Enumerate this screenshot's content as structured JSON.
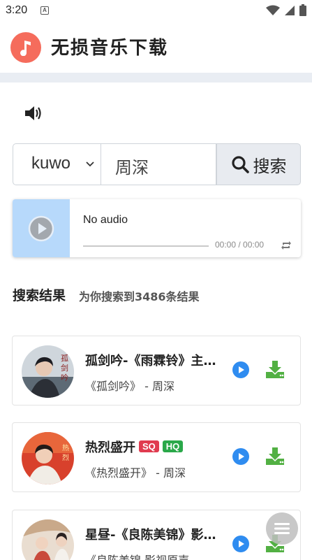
{
  "status_bar": {
    "time": "3:20",
    "notification_icon_letter": "A",
    "icons": [
      "notification-icon",
      "wifi-icon",
      "signal-icon",
      "battery-icon"
    ]
  },
  "header": {
    "title": "无损音乐下载",
    "logo_icon": "music-note-icon",
    "accent_color": "#f56c5c"
  },
  "search": {
    "source_selected": "kuwo",
    "query": "周深",
    "button_label": "搜索"
  },
  "player": {
    "title": "No audio",
    "time": "00:00 / 00:00",
    "progress": 0
  },
  "results": {
    "title": "搜索结果",
    "count_text": "为你搜索到3486条结果",
    "items": [
      {
        "title": "孤剑吟-《雨霖铃》主题曲",
        "subtitle": "《孤剑吟》 - 周深",
        "badges": []
      },
      {
        "title": "热烈盛开",
        "subtitle": "《热烈盛开》 - 周深",
        "badges": [
          "SQ",
          "HQ"
        ]
      },
      {
        "title": "星昼-《良陈美锦》影视原声",
        "subtitle": "《良陈美锦 影视原声",
        "badges": []
      }
    ]
  },
  "colors": {
    "play_blue": "#2f8cf0",
    "download_green": "#52b043",
    "badge_sq": "#e03b4f",
    "badge_hq": "#2aa84a"
  }
}
